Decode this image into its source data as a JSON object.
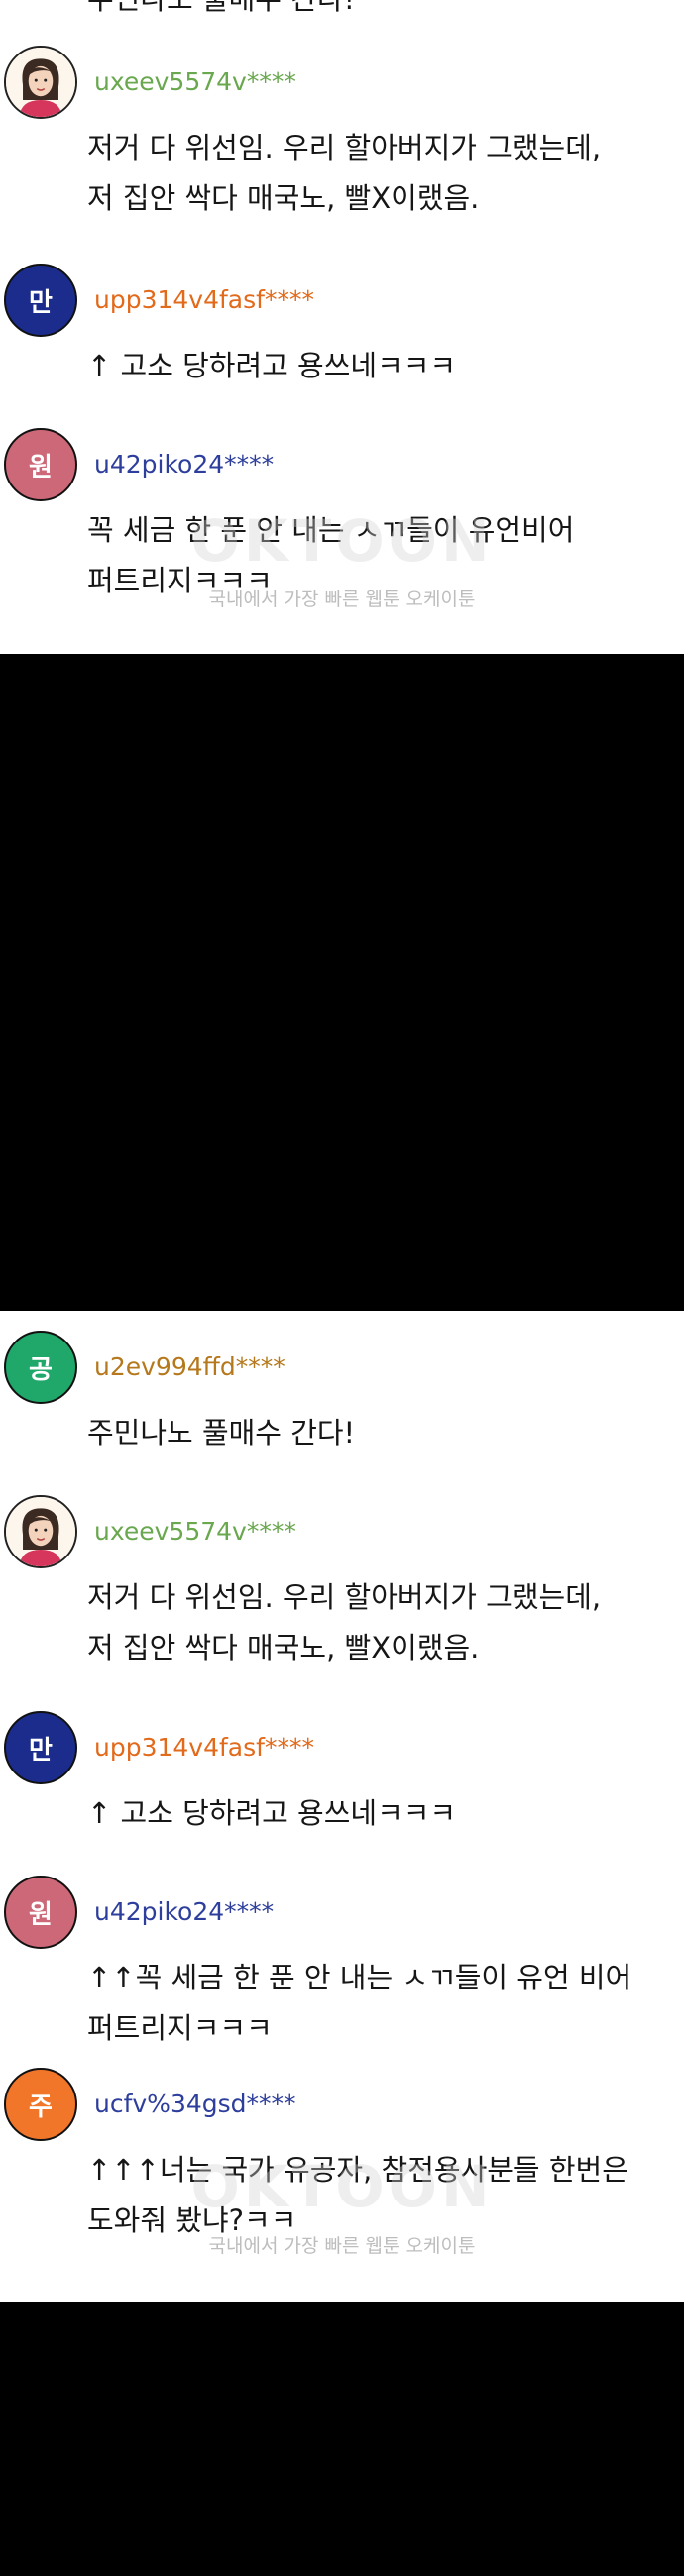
{
  "colors": {
    "avatar_green": "#1fa86a",
    "avatar_blue": "#1b2c8c",
    "avatar_pink": "#cc6878",
    "avatar_orange": "#f2762a",
    "user_green": "#6aa84f",
    "user_orange": "#e26a1b",
    "user_navy": "#2d3e9c",
    "user_goldbrown": "#b5781c"
  },
  "panel_top": {
    "cutoff_text": "주민나노 풀매수 간다!",
    "comments": [
      {
        "avatar_label": "",
        "avatar_type": "person-illustration",
        "username": "uxeev5574v****",
        "text": "저거 다 위선임. 우리 할아버지가 그랬는데,\n저 집안 싹다 매국노, 빨X이랬음."
      },
      {
        "avatar_label": "만",
        "username": "upp314v4fasf****",
        "text": "↑ 고소 당하려고 용쓰네ㅋㅋㅋ"
      },
      {
        "avatar_label": "원",
        "username": "u42piko24****",
        "text": "꼭 세금 한 푼 안 내는 ㅅㄲ들이 유언비어\n퍼트리지ㅋㅋㅋ"
      }
    ],
    "watermark": "OKTOON",
    "tagline": "국내에서 가장 빠른 웹툰 오케이툰"
  },
  "panel_bottom": {
    "comments": [
      {
        "avatar_label": "공",
        "username": "u2ev994ffd****",
        "text": "주민나노 풀매수 간다!"
      },
      {
        "avatar_label": "",
        "avatar_type": "person-illustration",
        "username": "uxeev5574v****",
        "text": "저거 다 위선임. 우리 할아버지가 그랬는데,\n저 집안 싹다 매국노, 빨X이랬음."
      },
      {
        "avatar_label": "만",
        "username": "upp314v4fasf****",
        "text": "↑ 고소 당하려고 용쓰네ㅋㅋㅋ"
      },
      {
        "avatar_label": "원",
        "username": "u42piko24****",
        "text": "↑↑꼭 세금 한 푼 안 내는 ㅅㄲ들이 유언 비어\n퍼트리지ㅋㅋㅋ"
      },
      {
        "avatar_label": "주",
        "username": "ucfv%34gsd****",
        "text": "↑↑↑너는 국가 유공자, 참전용사분들 한번은\n도와줘 봤냐?ㅋㅋ"
      }
    ],
    "watermark": "OKTOON",
    "tagline": "국내에서 가장 빠른 웹툰 오케이툰"
  }
}
